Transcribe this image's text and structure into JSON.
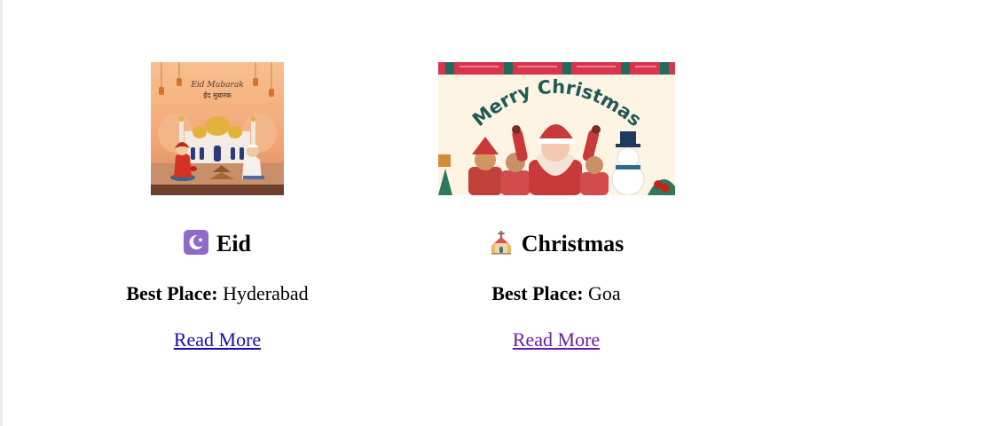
{
  "cards": [
    {
      "title": "Eid",
      "icon": "crescent-moon-icon",
      "best_place_label": "Best Place:",
      "best_place": "Hyderabad",
      "link_label": "Read More",
      "link_color": "#1a0dab",
      "image": {
        "banner_text_1": "Eid Mubarak",
        "banner_text_2": "ईद मुबारक"
      }
    },
    {
      "title": "Christmas",
      "icon": "church-icon",
      "best_place_label": "Best Place:",
      "best_place": "Goa",
      "link_label": "Read More",
      "link_color": "#681da8",
      "image": {
        "banner_text": "Merry Christmas"
      }
    }
  ]
}
